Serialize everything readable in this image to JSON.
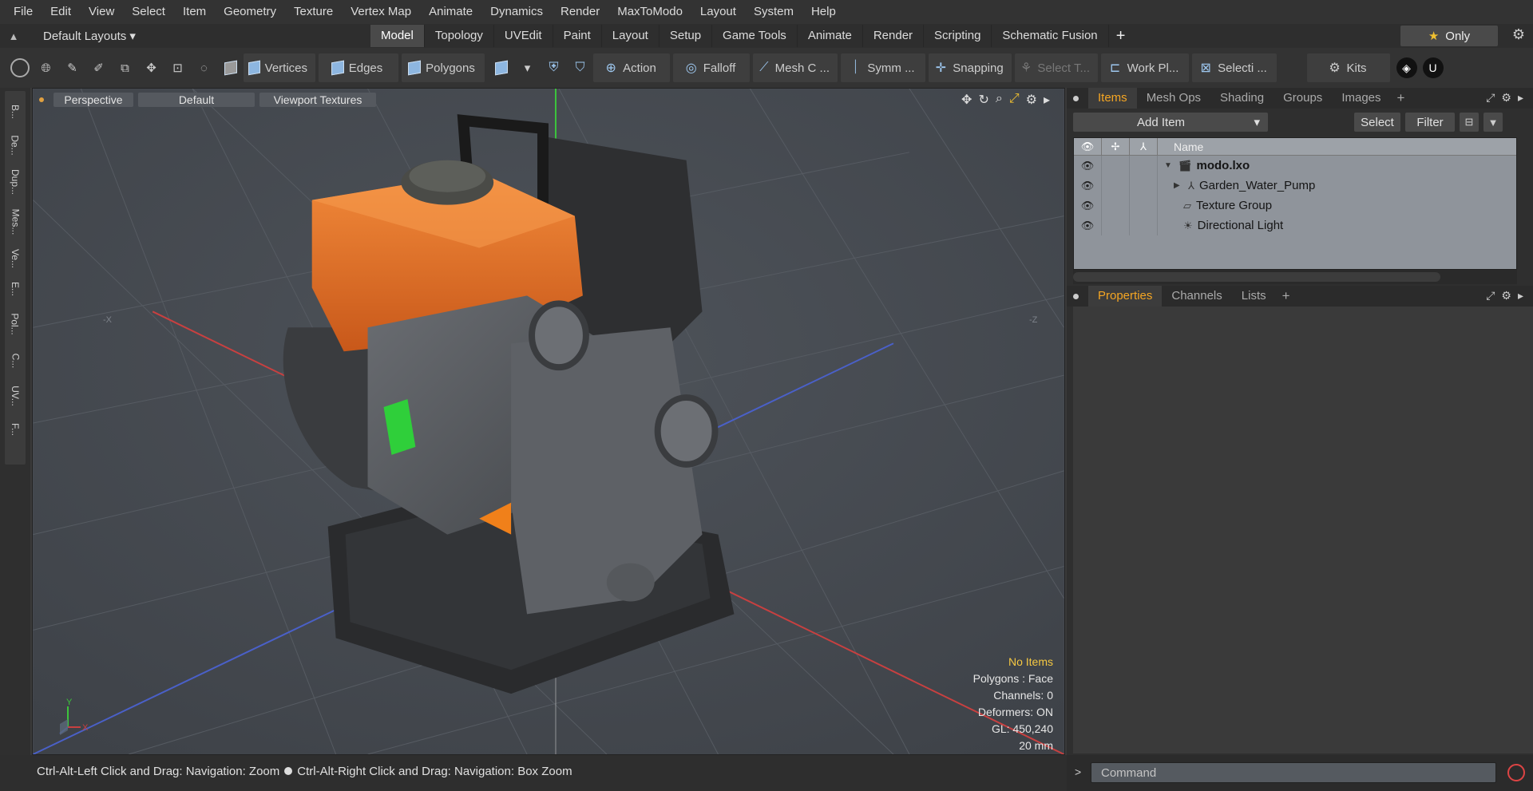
{
  "menubar": [
    "File",
    "Edit",
    "View",
    "Select",
    "Item",
    "Geometry",
    "Texture",
    "Vertex Map",
    "Animate",
    "Dynamics",
    "Render",
    "MaxToModo",
    "Layout",
    "System",
    "Help"
  ],
  "layoutbar": {
    "layout_selector": "Default Layouts",
    "tabs": [
      {
        "label": "Model",
        "active": true
      },
      {
        "label": "Topology"
      },
      {
        "label": "UVEdit"
      },
      {
        "label": "Paint"
      },
      {
        "label": "Layout"
      },
      {
        "label": "Setup"
      },
      {
        "label": "Game Tools"
      },
      {
        "label": "Animate"
      },
      {
        "label": "Render"
      },
      {
        "label": "Scripting"
      },
      {
        "label": "Schematic Fusion"
      }
    ],
    "add_tab": "+",
    "only_label": "Only"
  },
  "toolbar": {
    "vertices": "Vertices",
    "edges": "Edges",
    "polygons": "Polygons",
    "action": "Action",
    "falloff": "Falloff",
    "mesh_constraint": "Mesh C ...",
    "symmetry": "Symm ...",
    "snapping": "Snapping",
    "select_through": "Select T...",
    "work_plane": "Work Pl...",
    "selection_sets": "Selecti ...",
    "kits": "Kits"
  },
  "left_strip": [
    "B...",
    "De...",
    "Dup...",
    "Mes...",
    "Ve...",
    "E...",
    "Pol...",
    "C...",
    "UV...",
    "F..."
  ],
  "viewport": {
    "view_mode": "Perspective",
    "shading": "Default",
    "texture_mode": "Viewport Textures",
    "axis_neg_x": "-X",
    "axis_neg_z": "-Z",
    "info": {
      "selection": "No Items",
      "polygons": "Polygons : Face",
      "channels": "Channels: 0",
      "deformers": "Deformers: ON",
      "gl": "GL: 450,240",
      "scale": "20 mm"
    },
    "gizmo": {
      "y": "Y",
      "x": "X"
    }
  },
  "items_panel": {
    "tabs": [
      {
        "label": "Items",
        "active": true
      },
      {
        "label": "Mesh Ops"
      },
      {
        "label": "Shading"
      },
      {
        "label": "Groups"
      },
      {
        "label": "Images"
      }
    ],
    "add_item": "Add Item",
    "select": "Select",
    "filter": "Filter",
    "column_name": "Name",
    "tree": [
      {
        "name": "modo.lxo",
        "bold": true,
        "indent": 0,
        "expanded": true,
        "icon": "clapper-icon"
      },
      {
        "name": "Garden_Water_Pump",
        "indent": 1,
        "expandable": true,
        "icon": "locator-icon"
      },
      {
        "name": "Texture Group",
        "indent": 1,
        "icon": "folder-icon"
      },
      {
        "name": "Directional Light",
        "indent": 1,
        "icon": "light-icon"
      }
    ]
  },
  "properties_panel": {
    "tabs": [
      {
        "label": "Properties",
        "active": true
      },
      {
        "label": "Channels"
      },
      {
        "label": "Lists"
      }
    ]
  },
  "statusbar": {
    "hint_zoom": "Ctrl-Alt-Left Click and Drag: Navigation: Zoom",
    "hint_box_zoom": "Ctrl-Alt-Right Click and Drag: Navigation: Box Zoom"
  },
  "command": {
    "placeholder": "Command"
  },
  "colors": {
    "accent": "#f5a623",
    "viewport_bg": "#474b53",
    "pump_orange": "#e8762a"
  }
}
